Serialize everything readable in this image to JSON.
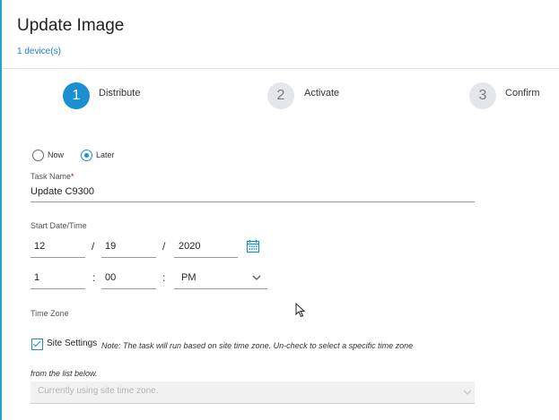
{
  "header": {
    "title": "Update Image",
    "device_count": "1 device(s)"
  },
  "steps": [
    {
      "number": "1",
      "label": "Distribute",
      "state": "active"
    },
    {
      "number": "2",
      "label": "Activate",
      "state": "inactive"
    },
    {
      "number": "3",
      "label": "Confirm",
      "state": "inactive"
    }
  ],
  "schedule": {
    "now_label": "Now",
    "later_label": "Later",
    "selected": "Later"
  },
  "task_name": {
    "label": "Task Name",
    "required_mark": "*",
    "value": "Update C9300"
  },
  "start_datetime": {
    "label": "Start Date/Time",
    "month": "12",
    "day": "19",
    "year": "2020",
    "date_separator": "/",
    "hour": "1",
    "minute": "00",
    "time_separator": ":",
    "meridiem": "PM"
  },
  "time_zone": {
    "label": "Time Zone",
    "site_settings_label": "Site Settings",
    "site_settings_checked": true,
    "note_line1": "Note: The task will run based on site time zone. Un-check to select a specific time zone",
    "note_line2": "from the list below.",
    "select_placeholder": "Currently using site time zone."
  },
  "colors": {
    "accent": "#1b8fd1",
    "link": "#1b7fcf",
    "left_border": "#1fa3c9"
  }
}
